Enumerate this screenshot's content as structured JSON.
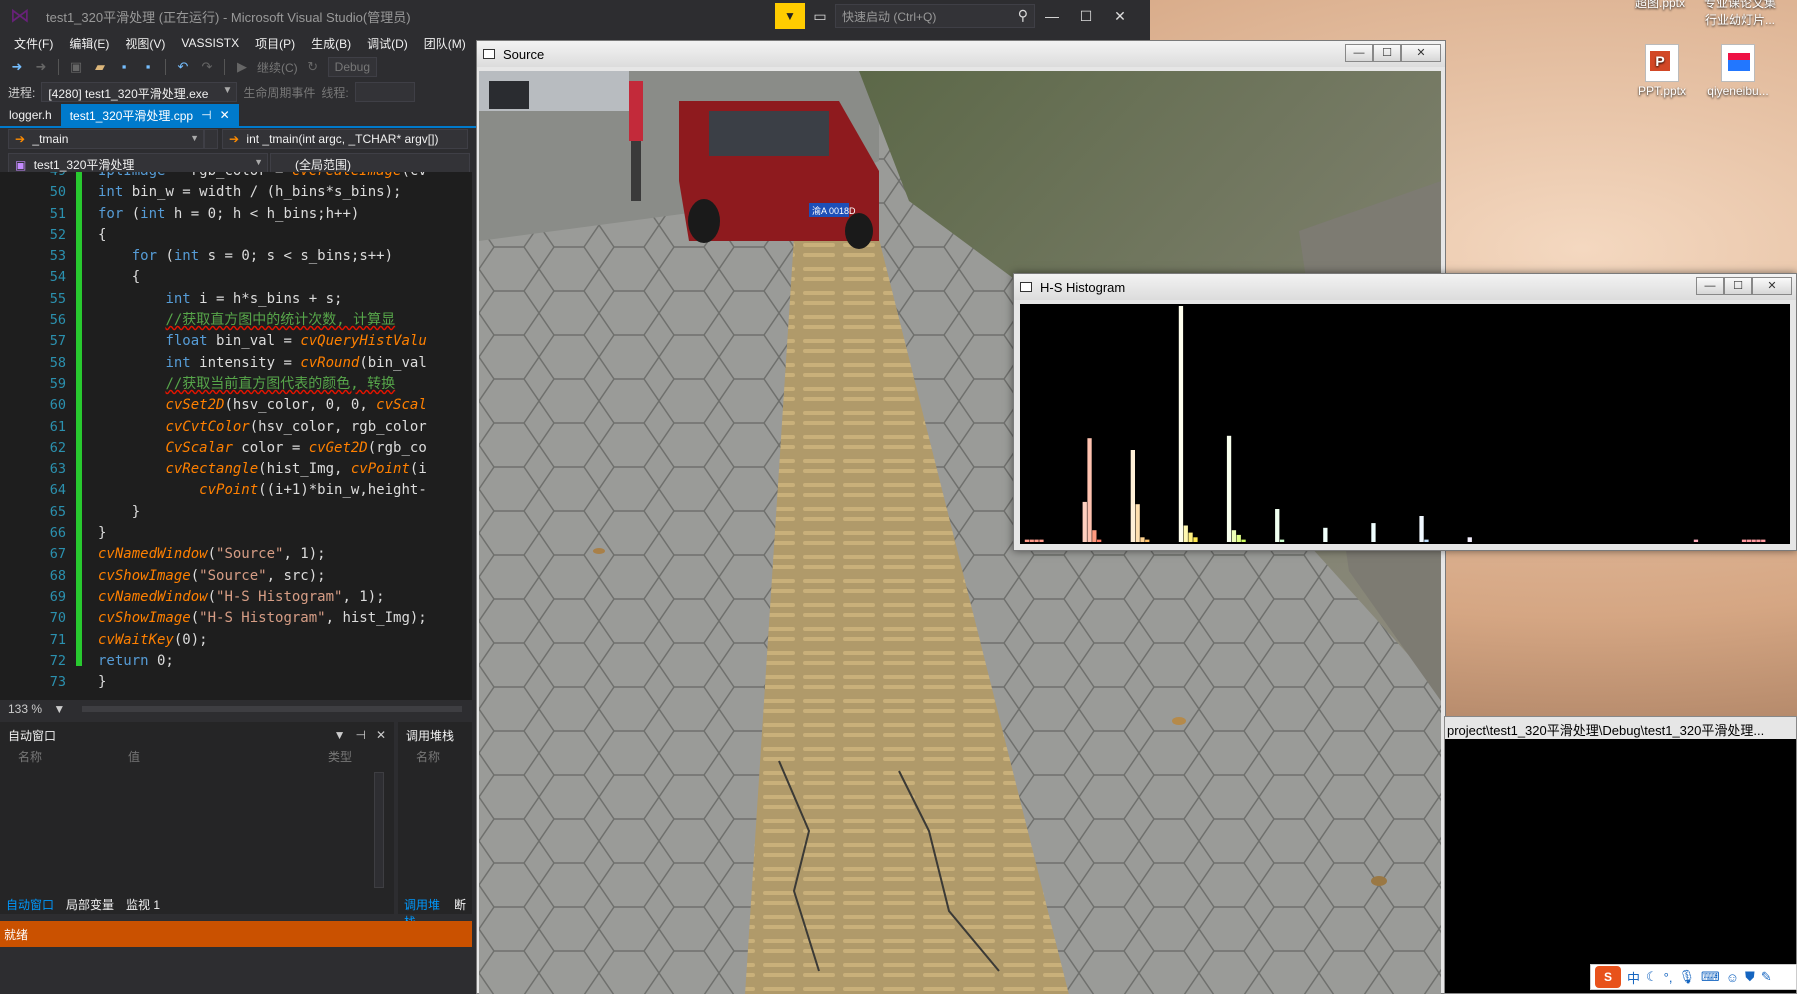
{
  "vs": {
    "title": "test1_320平滑处理 (正在运行) - Microsoft Visual Studio(管理员)",
    "quicklaunch_placeholder": "快速启动 (Ctrl+Q)",
    "menu": [
      "文件(F)",
      "编辑(E)",
      "视图(V)",
      "VASSISTX",
      "项目(P)",
      "生成(B)",
      "调试(D)",
      "团队(M)"
    ],
    "toolbar": {
      "continue_label": "继续(C)",
      "config": "Debug"
    },
    "procbar": {
      "label": "进程:",
      "process": "[4280] test1_320平滑处理.exe",
      "lifecycle": "生命周期事件",
      "thread_label": "线程:"
    },
    "tabs": [
      {
        "label": "logger.h"
      },
      {
        "label": "test1_320平滑处理.cpp"
      }
    ],
    "nav": {
      "scope": "_tmain",
      "member": "int _tmain(int argc, _TCHAR* argv[])",
      "project": "test1_320平滑处理",
      "range": "(全局范围)"
    },
    "zoom": "133 %",
    "status": "就绪"
  },
  "code": {
    "line_numbers": [
      "49",
      "50",
      "51",
      "52",
      "53",
      "54",
      "55",
      "56",
      "57",
      "58",
      "59",
      "60",
      "61",
      "62",
      "63",
      "64",
      "65",
      "66",
      "67",
      "68",
      "69",
      "70",
      "71",
      "72",
      "73"
    ],
    "lines": [
      "IplImage * rgb_color = cvCreateImage(cv",
      "int bin_w = width / (h_bins*s_bins);",
      "for (int h = 0; h < h_bins;h++)",
      "{",
      "    for (int s = 0; s < s_bins;s++)",
      "    {",
      "        int i = h*s_bins + s;",
      "        //获取直方图中的统计次数, 计算显",
      "        float bin_val = cvQueryHistValu",
      "        int intensity = cvRound(bin_val",
      "        //获取当前直方图代表的颜色, 转换",
      "        cvSet2D(hsv_color, 0, 0, cvScal",
      "        cvCvtColor(hsv_color, rgb_color",
      "        CvScalar color = cvGet2D(rgb_co",
      "        cvRectangle(hist_Img, cvPoint(i",
      "            cvPoint((i+1)*bin_w,height-",
      "    }",
      "}",
      "cvNamedWindow(\"Source\", 1);",
      "cvShowImage(\"Source\", src);",
      "cvNamedWindow(\"H-S Histogram\", 1);",
      "cvShowImage(\"H-S Histogram\", hist_Img);",
      "cvWaitKey(0);",
      "return 0;",
      "}"
    ]
  },
  "panels": {
    "autos": {
      "title": "自动窗口",
      "cols": [
        "名称",
        "值",
        "类型"
      ],
      "tabs": [
        "自动窗口",
        "局部变量",
        "监视 1"
      ]
    },
    "callstack": {
      "title": "调用堆栈",
      "cols": [
        "名称"
      ],
      "tabs": [
        "调用堆栈",
        "断"
      ]
    }
  },
  "source_win": {
    "title": "Source",
    "plate": "渝A 0018D"
  },
  "hist_win": {
    "title": "H-S Histogram"
  },
  "console_win": {
    "title": "project\\test1_320平滑处理\\Debug\\test1_320平滑处理..."
  },
  "desktop": {
    "icons": [
      {
        "label": "PPT.pptx"
      },
      {
        "label": "qiyeneibu..."
      }
    ],
    "top_texts": [
      "超图.pptx",
      "专业课论文集",
      "行业幼灯片..."
    ]
  },
  "chart_data": {
    "type": "bar",
    "title": "H-S Histogram",
    "note_values": "bar heights as fraction of histogram window height, 240 bins left to right (h major, s minor)",
    "bars": [
      {
        "bin": 1,
        "value": 0.01,
        "color": "#ff9a8a"
      },
      {
        "bin": 2,
        "value": 0.01,
        "color": "#ff9a8a"
      },
      {
        "bin": 3,
        "value": 0.01,
        "color": "#ff9a8a"
      },
      {
        "bin": 4,
        "value": 0.01,
        "color": "#ff9a8a"
      },
      {
        "bin": 13,
        "value": 0.17,
        "color": "#ffd0c0"
      },
      {
        "bin": 14,
        "value": 0.44,
        "color": "#ffc2b0"
      },
      {
        "bin": 15,
        "value": 0.05,
        "color": "#ff9a80"
      },
      {
        "bin": 16,
        "value": 0.01,
        "color": "#ff7d66"
      },
      {
        "bin": 23,
        "value": 0.39,
        "color": "#fff0d8"
      },
      {
        "bin": 24,
        "value": 0.16,
        "color": "#ffe0b0"
      },
      {
        "bin": 25,
        "value": 0.02,
        "color": "#ffd290"
      },
      {
        "bin": 26,
        "value": 0.01,
        "color": "#ffc066"
      },
      {
        "bin": 33,
        "value": 1.0,
        "color": "#ffffee"
      },
      {
        "bin": 34,
        "value": 0.07,
        "color": "#fff8b0"
      },
      {
        "bin": 35,
        "value": 0.04,
        "color": "#fff080"
      },
      {
        "bin": 36,
        "value": 0.02,
        "color": "#ffe850"
      },
      {
        "bin": 43,
        "value": 0.45,
        "color": "#f8ffee"
      },
      {
        "bin": 44,
        "value": 0.05,
        "color": "#eeffb8"
      },
      {
        "bin": 45,
        "value": 0.03,
        "color": "#e0ff88"
      },
      {
        "bin": 46,
        "value": 0.01,
        "color": "#d0ff60"
      },
      {
        "bin": 53,
        "value": 0.14,
        "color": "#f0fff0"
      },
      {
        "bin": 54,
        "value": 0.01,
        "color": "#ccffcc"
      },
      {
        "bin": 63,
        "value": 0.06,
        "color": "#f0fffa"
      },
      {
        "bin": 73,
        "value": 0.08,
        "color": "#f0ffff"
      },
      {
        "bin": 83,
        "value": 0.11,
        "color": "#f0f8ff"
      },
      {
        "bin": 84,
        "value": 0.01,
        "color": "#c0e0ff"
      },
      {
        "bin": 93,
        "value": 0.02,
        "color": "#f4f0ff"
      },
      {
        "bin": 140,
        "value": 0.01,
        "color": "#ffb0c0"
      },
      {
        "bin": 150,
        "value": 0.01,
        "color": "#ff9aa0"
      },
      {
        "bin": 151,
        "value": 0.01,
        "color": "#ff9aa0"
      },
      {
        "bin": 152,
        "value": 0.01,
        "color": "#ff9aa0"
      },
      {
        "bin": 153,
        "value": 0.01,
        "color": "#ff9aa0"
      },
      {
        "bin": 154,
        "value": 0.01,
        "color": "#ff9aa0"
      }
    ],
    "bin_count": 160
  }
}
